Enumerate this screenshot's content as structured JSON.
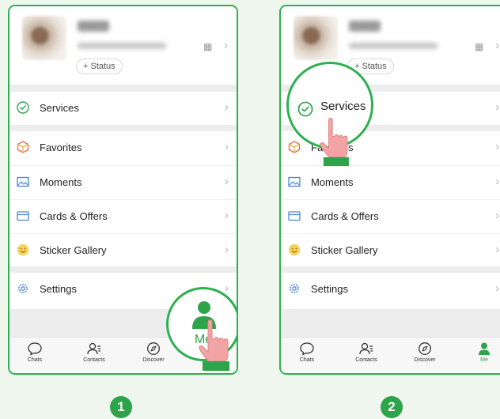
{
  "profile": {
    "status_label": "+ Status"
  },
  "menu": {
    "services": "Services",
    "favorites": "Favorites",
    "moments": "Moments",
    "cards_offers": "Cards & Offers",
    "sticker_gallery": "Sticker Gallery",
    "settings": "Settings"
  },
  "tabs": {
    "chats": "Chats",
    "contacts": "Contacts",
    "discover": "Discover",
    "me": "Me"
  },
  "magnifier": {
    "step1_label": "Me",
    "step2_label": "Services"
  },
  "steps": {
    "one": "1",
    "two": "2"
  },
  "colors": {
    "accent": "#2da34a",
    "border": "#2db050",
    "hand": "#f2a3a3",
    "separator": "#ededed"
  }
}
